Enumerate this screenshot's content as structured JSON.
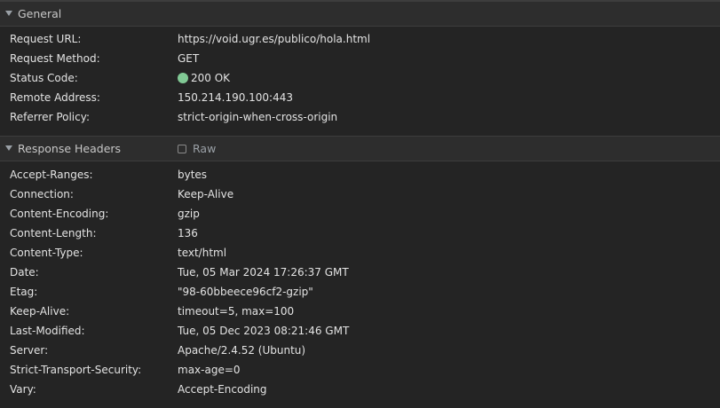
{
  "general": {
    "title": "General",
    "rows": [
      {
        "key": "Request URL:",
        "value": "https://void.ugr.es/publico/hola.html"
      },
      {
        "key": "Request Method:",
        "value": "GET"
      },
      {
        "key": "Status Code:",
        "value": "200 OK"
      },
      {
        "key": "Remote Address:",
        "value": "150.214.190.100:443"
      },
      {
        "key": "Referrer Policy:",
        "value": "strict-origin-when-cross-origin"
      }
    ],
    "status_color": "#81c995"
  },
  "response_headers": {
    "title": "Response Headers",
    "raw_label": "Raw",
    "rows": [
      {
        "key": "Accept-Ranges:",
        "value": "bytes"
      },
      {
        "key": "Connection:",
        "value": "Keep-Alive"
      },
      {
        "key": "Content-Encoding:",
        "value": "gzip"
      },
      {
        "key": "Content-Length:",
        "value": "136"
      },
      {
        "key": "Content-Type:",
        "value": "text/html"
      },
      {
        "key": "Date:",
        "value": "Tue, 05 Mar 2024 17:26:37 GMT"
      },
      {
        "key": "Etag:",
        "value": "\"98-60bbeece96cf2-gzip\""
      },
      {
        "key": "Keep-Alive:",
        "value": "timeout=5, max=100"
      },
      {
        "key": "Last-Modified:",
        "value": "Tue, 05 Dec 2023 08:21:46 GMT"
      },
      {
        "key": "Server:",
        "value": "Apache/2.4.52 (Ubuntu)"
      },
      {
        "key": "Strict-Transport-Security:",
        "value": "max-age=0"
      },
      {
        "key": "Vary:",
        "value": "Accept-Encoding"
      }
    ]
  }
}
